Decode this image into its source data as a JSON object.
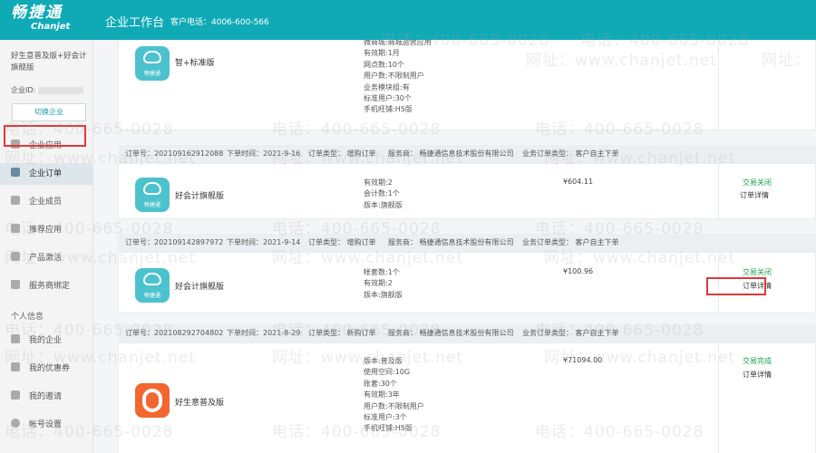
{
  "header": {
    "logo_cn": "畅捷通",
    "logo_en": "Chanjet",
    "title": "企业工作台",
    "phone": "客户电话：4006-600-566"
  },
  "sidebar": {
    "company_name": "好生意普及版+好会计旗舰版",
    "company_id_label": "企业ID:",
    "switch_label": "切换企业",
    "items": [
      {
        "label": "企业应用",
        "icon": "grid-icon"
      },
      {
        "label": "企业订单",
        "icon": "document-icon"
      },
      {
        "label": "企业成员",
        "icon": "building-icon"
      },
      {
        "label": "推荐应用",
        "icon": "star-icon"
      },
      {
        "label": "产品激活",
        "icon": "card-icon"
      },
      {
        "label": "服务商绑定",
        "icon": "link-icon"
      }
    ],
    "personal_label": "个人信息",
    "personal_items": [
      {
        "label": "我的企业",
        "icon": "bag-icon"
      },
      {
        "label": "我的优惠券",
        "icon": "coupon-icon"
      },
      {
        "label": "我的邀请",
        "icon": "user-icon"
      },
      {
        "label": "帐号设置",
        "icon": "gear-icon"
      }
    ]
  },
  "orders": [
    {
      "app_name": "智+标准版",
      "icon_caption": "畅捷通",
      "specs": [
        "微商城:商城运营应用",
        "有效期:1月",
        "网点数:10个",
        "用户数:不限制用户",
        "业务模块组:有",
        "标准用户:30个",
        "手机旺铺:H5版"
      ]
    },
    {
      "order_no": "订单号：202109162912088",
      "order_time": "下单时间：2021-9-16",
      "order_type": "订单类型：  增购订单",
      "provider": "服务商：  畅捷通信息技术股份有限公司",
      "biz_type": "业务订单类型：  客户自主下单",
      "app_name": "好会计旗舰版",
      "icon_caption": "畅捷通",
      "specs": [
        "有效期:2",
        "会计数:1个",
        "版本:旗舰版"
      ],
      "price": "¥604.11",
      "status": "交易关闭",
      "detail": "订单详情"
    },
    {
      "order_no": "订单号：202109142897972",
      "order_time": "下单时间：2021-9-14",
      "order_type": "订单类型：  增购订单",
      "provider": "服务商：  畅捷通信息技术股份有限公司",
      "biz_type": "业务订单类型：  客户自主下单",
      "app_name": "好会计旗舰版",
      "icon_caption": "畅捷通",
      "specs": [
        "帐套数:1个",
        "有效期:2",
        "版本:旗舰版"
      ],
      "price": "¥100.96",
      "status": "交易关闭",
      "detail": "订单详情"
    },
    {
      "order_no": "订单号：202108292704802",
      "order_time": "下单时间：2021-8-29",
      "order_type": "订单类型：  新购订单",
      "provider": "服务商：  畅捷通信息技术股份有限公司",
      "biz_type": "业务订单类型：  客户自主下单",
      "app_name": "好生意普及版",
      "specs": [
        "版本:普及版",
        "使用空间:10G",
        "账套:30个",
        "有效期:3年",
        "用户数:不限制用户",
        "标准用户:3个",
        "手机旺铺:H5版"
      ],
      "price": "¥71094.00",
      "status": "交易完成",
      "detail": "订单详情"
    }
  ],
  "watermark": {
    "phone": "电话：400-665-0028",
    "site_label": "网址：",
    "site": "www.chanjet.net"
  },
  "colors": {
    "header": "#10aab7",
    "status_green": "#1aa24a",
    "highlight_red": "#e0383a",
    "app_teal": "#4dc2cf",
    "app_orange": "#f2672f"
  }
}
